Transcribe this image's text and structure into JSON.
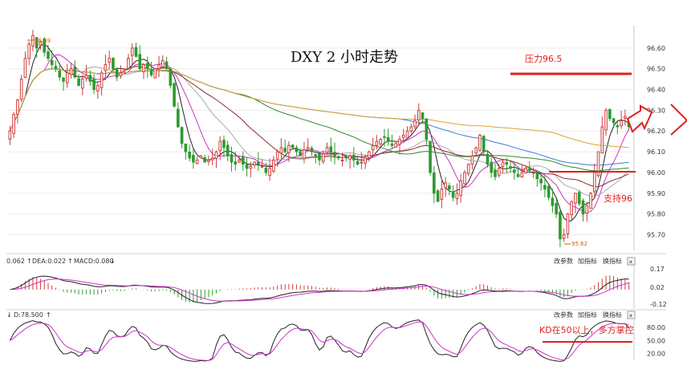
{
  "title": "DXY 2 小时走势",
  "colors": {
    "up": "#d23c3c",
    "down": "#2e9a2e",
    "ma_black": "#222222",
    "ma_magenta": "#cc33cc",
    "ma_brown": "#8b2e2e",
    "ma_green": "#2e8b2e",
    "ma_blue": "#3a7ad0",
    "ma_orange": "#e0a030",
    "ann": "#e02020"
  },
  "annotations": {
    "resistance_label": "压力96.5",
    "support_label": "支持96",
    "kd_note": "KD在50以上，多方掌控",
    "high_mark": "96.69",
    "low_mark": "95.62"
  },
  "macd_panel": {
    "label_diff": "0.062",
    "label_dea": "DEA:0.022",
    "label_macd": "MACD:0.080",
    "ticks": [
      "0.17",
      "0.02",
      "-0.12"
    ]
  },
  "kd_panel": {
    "label": "D:78.500",
    "ticks": [
      "80.00",
      "50.00",
      "20.00"
    ]
  },
  "toolbar": {
    "params": "改参数",
    "add": "加指标",
    "change": "换指标",
    "close": "✕"
  },
  "chart_data": [
    {
      "type": "candlestick",
      "title": "DXY 2 小时走势",
      "y_ticks": [
        96.6,
        96.5,
        96.4,
        96.3,
        96.2,
        96.1,
        96.0,
        95.9,
        95.8,
        95.7
      ],
      "ylim": [
        95.64,
        96.7
      ],
      "grid": true,
      "resistance": 96.5,
      "support": 96.0,
      "high": 96.69,
      "low": 95.62,
      "closes": [
        96.2,
        96.28,
        96.35,
        96.45,
        96.55,
        96.62,
        96.66,
        96.6,
        96.63,
        96.58,
        96.55,
        96.52,
        96.5,
        96.46,
        96.44,
        96.48,
        96.5,
        96.46,
        96.42,
        96.45,
        96.47,
        96.44,
        96.4,
        96.42,
        96.48,
        96.52,
        96.55,
        96.5,
        96.46,
        96.48,
        96.5,
        96.55,
        96.6,
        96.56,
        96.5,
        96.52,
        96.5,
        96.47,
        96.5,
        96.52,
        96.54,
        96.5,
        96.42,
        96.32,
        96.22,
        96.14,
        96.1,
        96.07,
        96.05,
        96.06,
        96.08,
        96.05,
        96.06,
        96.07,
        96.1,
        96.15,
        96.12,
        96.08,
        96.05,
        96.04,
        96.06,
        96.04,
        96.02,
        96.03,
        96.05,
        96.04,
        96.03,
        96.0,
        96.02,
        96.06,
        96.1,
        96.12,
        96.1,
        96.13,
        96.12,
        96.1,
        96.08,
        96.11,
        96.12,
        96.1,
        96.08,
        96.06,
        96.09,
        96.12,
        96.1,
        96.08,
        96.07,
        96.06,
        96.07,
        96.08,
        96.06,
        96.04,
        96.05,
        96.07,
        96.1,
        96.13,
        96.15,
        96.16,
        96.17,
        96.15,
        96.13,
        96.14,
        96.16,
        96.18,
        96.2,
        96.22,
        96.25,
        96.3,
        96.26,
        96.16,
        96.0,
        95.9,
        95.86,
        95.92,
        95.95,
        95.92,
        95.88,
        95.9,
        95.96,
        96.0,
        96.04,
        96.08,
        96.12,
        96.18,
        96.1,
        96.04,
        96.0,
        95.98,
        96.02,
        96.05,
        96.04,
        96.02,
        96.0,
        95.98,
        96.0,
        96.02,
        96.01,
        96.0,
        95.97,
        95.95,
        95.92,
        95.88,
        95.84,
        95.8,
        95.68,
        95.7,
        95.8,
        95.86,
        95.9,
        95.85,
        95.8,
        95.84,
        95.9,
        96.0,
        96.1,
        96.22,
        96.3,
        96.26,
        96.24,
        96.22,
        96.25,
        96.27,
        96.22
      ]
    },
    {
      "type": "bar",
      "title": "MACD",
      "ylim": [
        -0.14,
        0.19
      ],
      "y_ticks": [
        0.17,
        0.02,
        -0.12
      ],
      "dif": 0.062,
      "dea": 0.022,
      "macd": 0.08
    },
    {
      "type": "line",
      "title": "KD",
      "ylim": [
        10,
        95
      ],
      "y_ticks": [
        80,
        50,
        20
      ],
      "d": 78.5
    }
  ]
}
